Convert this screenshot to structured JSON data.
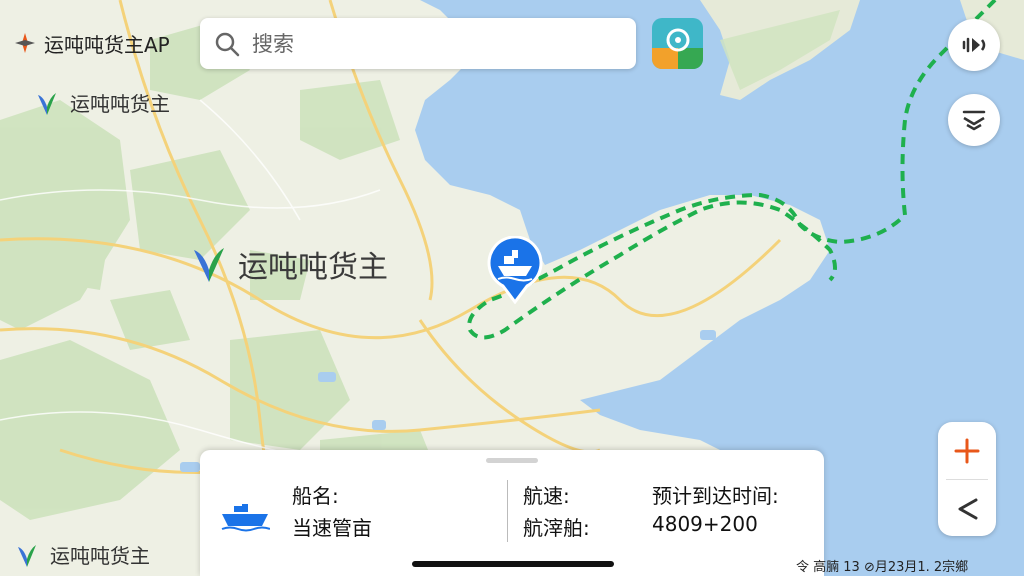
{
  "app_title": "运吨吨货主AP",
  "watermark": {
    "top": "运吨吨货主",
    "center": "运吨吨货主",
    "bottom": "运吨吨货主"
  },
  "search": {
    "placeholder": "搜索"
  },
  "ship_card": {
    "name_label": "船名:",
    "name_value": "当速管亩",
    "speed_label": "航速:",
    "speed_value": "航滓舶:",
    "eta_label": "预计到达时间:",
    "eta_value": "4809+200"
  },
  "status_bar": {
    "text": "令 高腩 13 ⊘月23月1. 2宗鄉"
  },
  "icons": {
    "app_logo": "compass-logo-icon",
    "search": "search-icon",
    "app_shortcut": "app-shortcut-icon",
    "sound": "sound-toggle-icon",
    "layers": "layers-icon",
    "zoom_in": "plus-icon",
    "back": "chevron-left-icon",
    "ship": "ship-icon",
    "marker": "ship-location-marker-icon"
  },
  "colors": {
    "sea": "#a9cdef",
    "land": "#eef0e4",
    "route": "#1fb04d",
    "marker": "#1a73e8",
    "zoom_plus": "#e8571a"
  }
}
